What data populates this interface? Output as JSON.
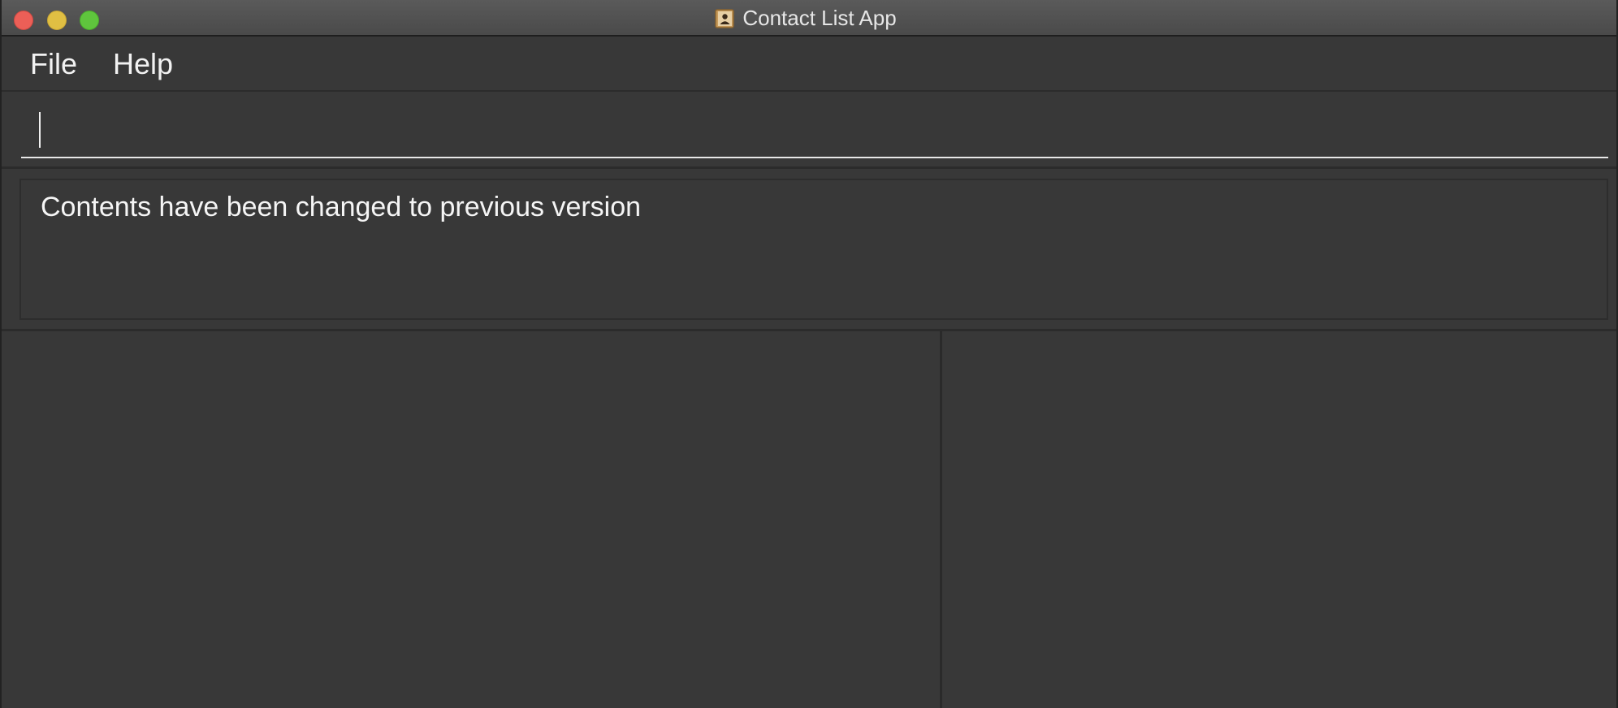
{
  "window": {
    "title": "Contact List App",
    "icon": "contact-book-icon"
  },
  "menu": {
    "items": [
      {
        "label": "File"
      },
      {
        "label": "Help"
      }
    ]
  },
  "command": {
    "value": "",
    "placeholder": ""
  },
  "result": {
    "message": "Contents have been changed to previous version"
  },
  "colors": {
    "background": "#383838",
    "text": "#f5f5f5",
    "close": "#ec5f57",
    "minimize": "#e0bf43",
    "maximize": "#5fc53d"
  }
}
